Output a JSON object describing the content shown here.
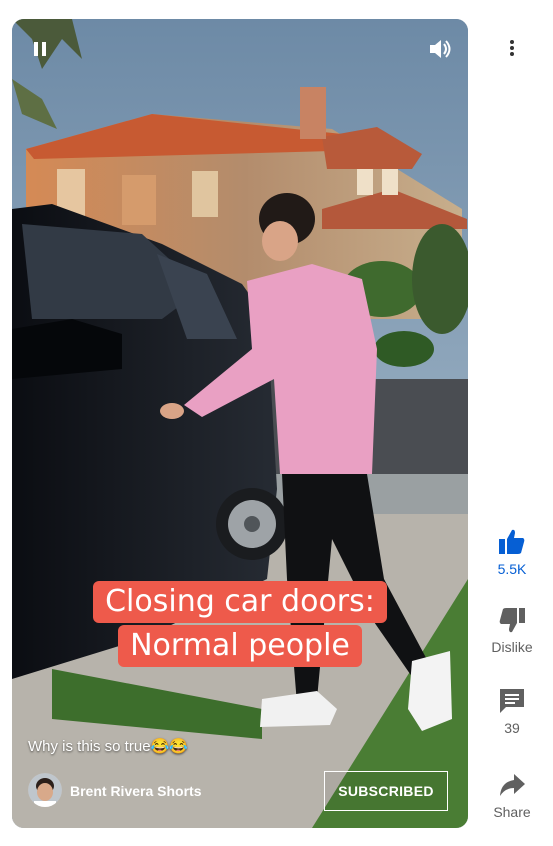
{
  "video": {
    "caption_line1": "Closing car doors:",
    "caption_line2": "Normal people",
    "title": "Why is this so true😂😂",
    "channel_name": "Brent Rivera Shorts",
    "subscribe_label": "SUBSCRIBED",
    "controls": {
      "pause_icon": "pause-icon",
      "volume_icon": "volume-icon"
    }
  },
  "rail": {
    "like_count": "5.5K",
    "dislike_label": "Dislike",
    "comment_count": "39",
    "share_label": "Share",
    "like_color": "#065fd4"
  },
  "colors": {
    "caption_bg": "#ee5a4b",
    "text_secondary": "#606060"
  }
}
